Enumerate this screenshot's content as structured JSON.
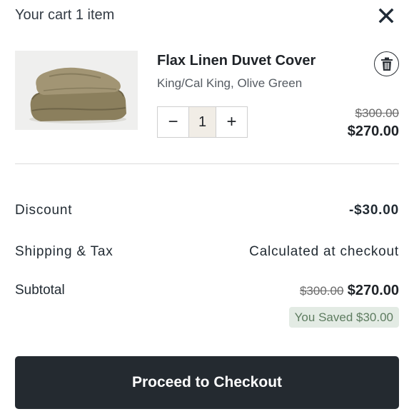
{
  "header": {
    "title": "Your cart 1 item",
    "close_icon": "close-icon"
  },
  "item": {
    "name": "Flax Linen Duvet Cover",
    "variant": "King/Cal King, Olive Green",
    "quantity": "1",
    "decrement_label": "−",
    "increment_label": "+",
    "original_price": "$300.00",
    "sale_price": "$270.00",
    "delete_icon": "trash-icon",
    "image_color": "#9c8f6c"
  },
  "summary": {
    "discount_label": "Discount",
    "discount_value": "-$30.00",
    "shipping_label": "Shipping & Tax",
    "shipping_value": "Calculated at checkout",
    "subtotal_label": "Subtotal",
    "subtotal_original": "$300.00",
    "subtotal_sale": "$270.00",
    "saved_text": "You Saved $30.00"
  },
  "checkout": {
    "label": "Proceed to Checkout",
    "color": "#242a30"
  }
}
